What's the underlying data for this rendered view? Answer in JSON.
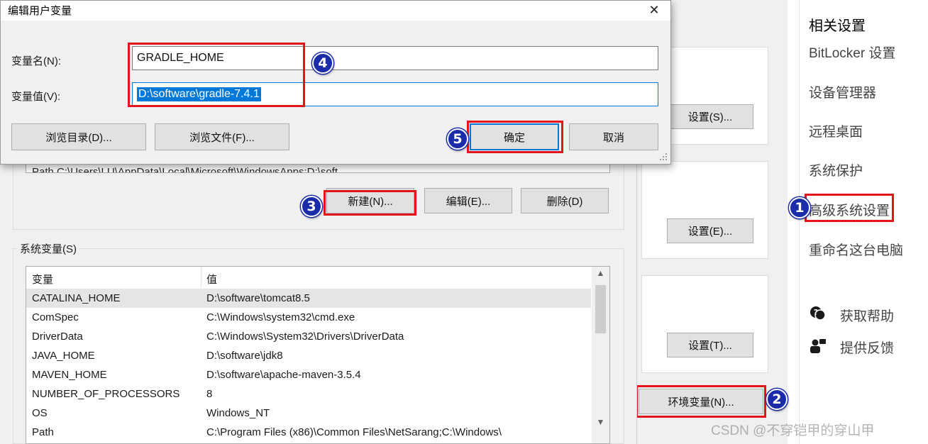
{
  "dialog": {
    "title": "编辑用户变量",
    "close_glyph": "✕",
    "var_name_label": "变量名(N):",
    "var_value_label": "变量值(V):",
    "var_name_value": "GRADLE_HOME",
    "var_value_value": "D:\\software\\gradle-7.4.1",
    "browse_dir_label": "浏览目录(D)...",
    "browse_file_label": "浏览文件(F)...",
    "ok_label": "确定",
    "cancel_label": "取消"
  },
  "env_window": {
    "user_vars_partial_row": "Path   C:\\Users\\LU\\AppData\\Local\\Microsoft\\WindowsApps;D:\\soft",
    "new_label": "新建(N)...",
    "edit_label": "编辑(E)...",
    "delete_label": "删除(D)",
    "system_vars_group_label": "系统变量(S)",
    "columns": [
      "变量",
      "值"
    ],
    "rows": [
      {
        "name": "CATALINA_HOME",
        "value": "D:\\software\\tomcat8.5"
      },
      {
        "name": "ComSpec",
        "value": "C:\\Windows\\system32\\cmd.exe"
      },
      {
        "name": "DriverData",
        "value": "C:\\Windows\\System32\\Drivers\\DriverData"
      },
      {
        "name": "JAVA_HOME",
        "value": "D:\\software\\jdk8"
      },
      {
        "name": "MAVEN_HOME",
        "value": "D:\\software\\apache-maven-3.5.4"
      },
      {
        "name": "NUMBER_OF_PROCESSORS",
        "value": "8"
      },
      {
        "name": "OS",
        "value": "Windows_NT"
      },
      {
        "name": "Path",
        "value": "C:\\Program Files (x86)\\Common Files\\NetSarang;C:\\Windows\\"
      }
    ]
  },
  "sys_props": {
    "settings_s_label": "设置(S)...",
    "settings_e_label": "设置(E)...",
    "settings_t_label": "设置(T)...",
    "env_vars_label": "环境变量(N)..."
  },
  "right_panel": {
    "heading": "相关设置",
    "links": [
      "BitLocker 设置",
      "设备管理器",
      "远程桌面",
      "系统保护",
      "高级系统设置",
      "重命名这台电脑"
    ],
    "help_label": "获取帮助",
    "feedback_label": "提供反馈",
    "help_icon": "help-chat-icon",
    "feedback_icon": "feedback-person-icon"
  },
  "badges": [
    "1",
    "2",
    "3",
    "4",
    "5"
  ],
  "watermark": "CSDN @不穿铠甲的穿山甲",
  "colors": {
    "highlight_box": "#e3151a",
    "badge_fill": "#1a2ca8",
    "selection_bg": "#0078d7",
    "button_bg": "#e1e1e1"
  }
}
